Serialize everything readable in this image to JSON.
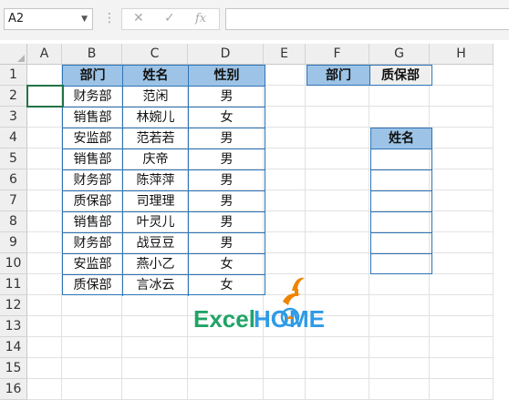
{
  "formula_bar": {
    "name_box": "A2",
    "cancel_icon": "✕",
    "enter_icon": "✓",
    "fx_label": "fx",
    "formula": ""
  },
  "columns": [
    "A",
    "B",
    "C",
    "D",
    "E",
    "F",
    "G",
    "H"
  ],
  "rows": [
    "1",
    "2",
    "3",
    "4",
    "5",
    "6",
    "7",
    "8",
    "9",
    "10",
    "11",
    "12",
    "13",
    "14",
    "15",
    "16"
  ],
  "table": {
    "headers": [
      "部门",
      "姓名",
      "性别"
    ],
    "rows": [
      [
        "财务部",
        "范闲",
        "男"
      ],
      [
        "销售部",
        "林婉儿",
        "女"
      ],
      [
        "安监部",
        "范若若",
        "男"
      ],
      [
        "销售部",
        "庆帝",
        "男"
      ],
      [
        "财务部",
        "陈萍萍",
        "男"
      ],
      [
        "质保部",
        "司理理",
        "男"
      ],
      [
        "销售部",
        "叶灵儿",
        "男"
      ],
      [
        "财务部",
        "战豆豆",
        "男"
      ],
      [
        "安监部",
        "燕小乙",
        "女"
      ],
      [
        "质保部",
        "言冰云",
        "女"
      ]
    ]
  },
  "criteria": {
    "label": "部门",
    "value": "质保部"
  },
  "result": {
    "header": "姓名",
    "values": [
      "",
      "",
      "",
      "",
      "",
      ""
    ]
  },
  "logo": {
    "part1": "Excel",
    "part2": "HOME"
  },
  "colors": {
    "header_fill": "#9dc3e6",
    "border": "#2e74b5",
    "logo_green": "#21a366",
    "logo_blue": "#2e9be6",
    "logo_orange": "#f08300"
  }
}
